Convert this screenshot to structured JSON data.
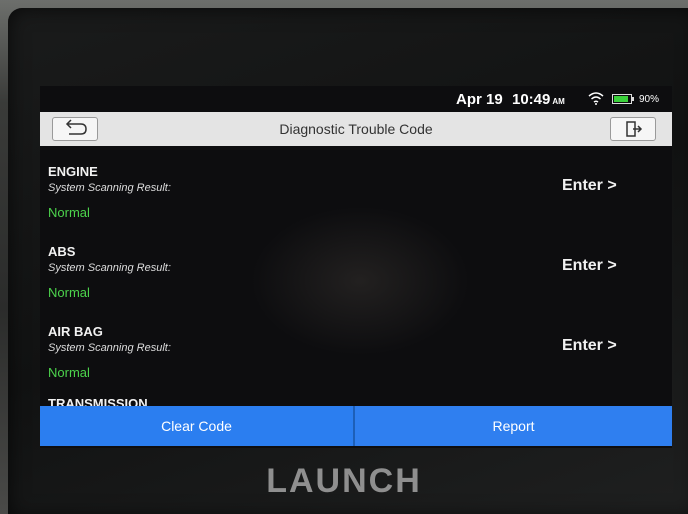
{
  "status_bar": {
    "date": "Apr 19",
    "time": "10:49",
    "ampm": "AM",
    "battery": "90%",
    "battery_level": 0.9
  },
  "header": {
    "title": "Diagnostic Trouble Code"
  },
  "systems": [
    {
      "name": "ENGINE",
      "sub": "System Scanning Result:",
      "status": "Normal",
      "enter": "Enter >"
    },
    {
      "name": "ABS",
      "sub": "System Scanning Result:",
      "status": "Normal",
      "enter": "Enter >"
    },
    {
      "name": "AIR BAG",
      "sub": "System Scanning Result:",
      "status": "Normal",
      "enter": "Enter >"
    }
  ],
  "partial_item": "TRANSMISSION",
  "buttons": {
    "clear_code": "Clear Code",
    "report": "Report"
  },
  "logo": "LAUNCH",
  "colors": {
    "accent_blue": "#2b7ef0",
    "status_green": "#4cd34c",
    "header_bg": "#e4e4e4"
  },
  "icons": {
    "back": "back-arrow-icon",
    "exit": "exit-icon",
    "wifi": "wifi-icon",
    "battery": "battery-icon"
  }
}
